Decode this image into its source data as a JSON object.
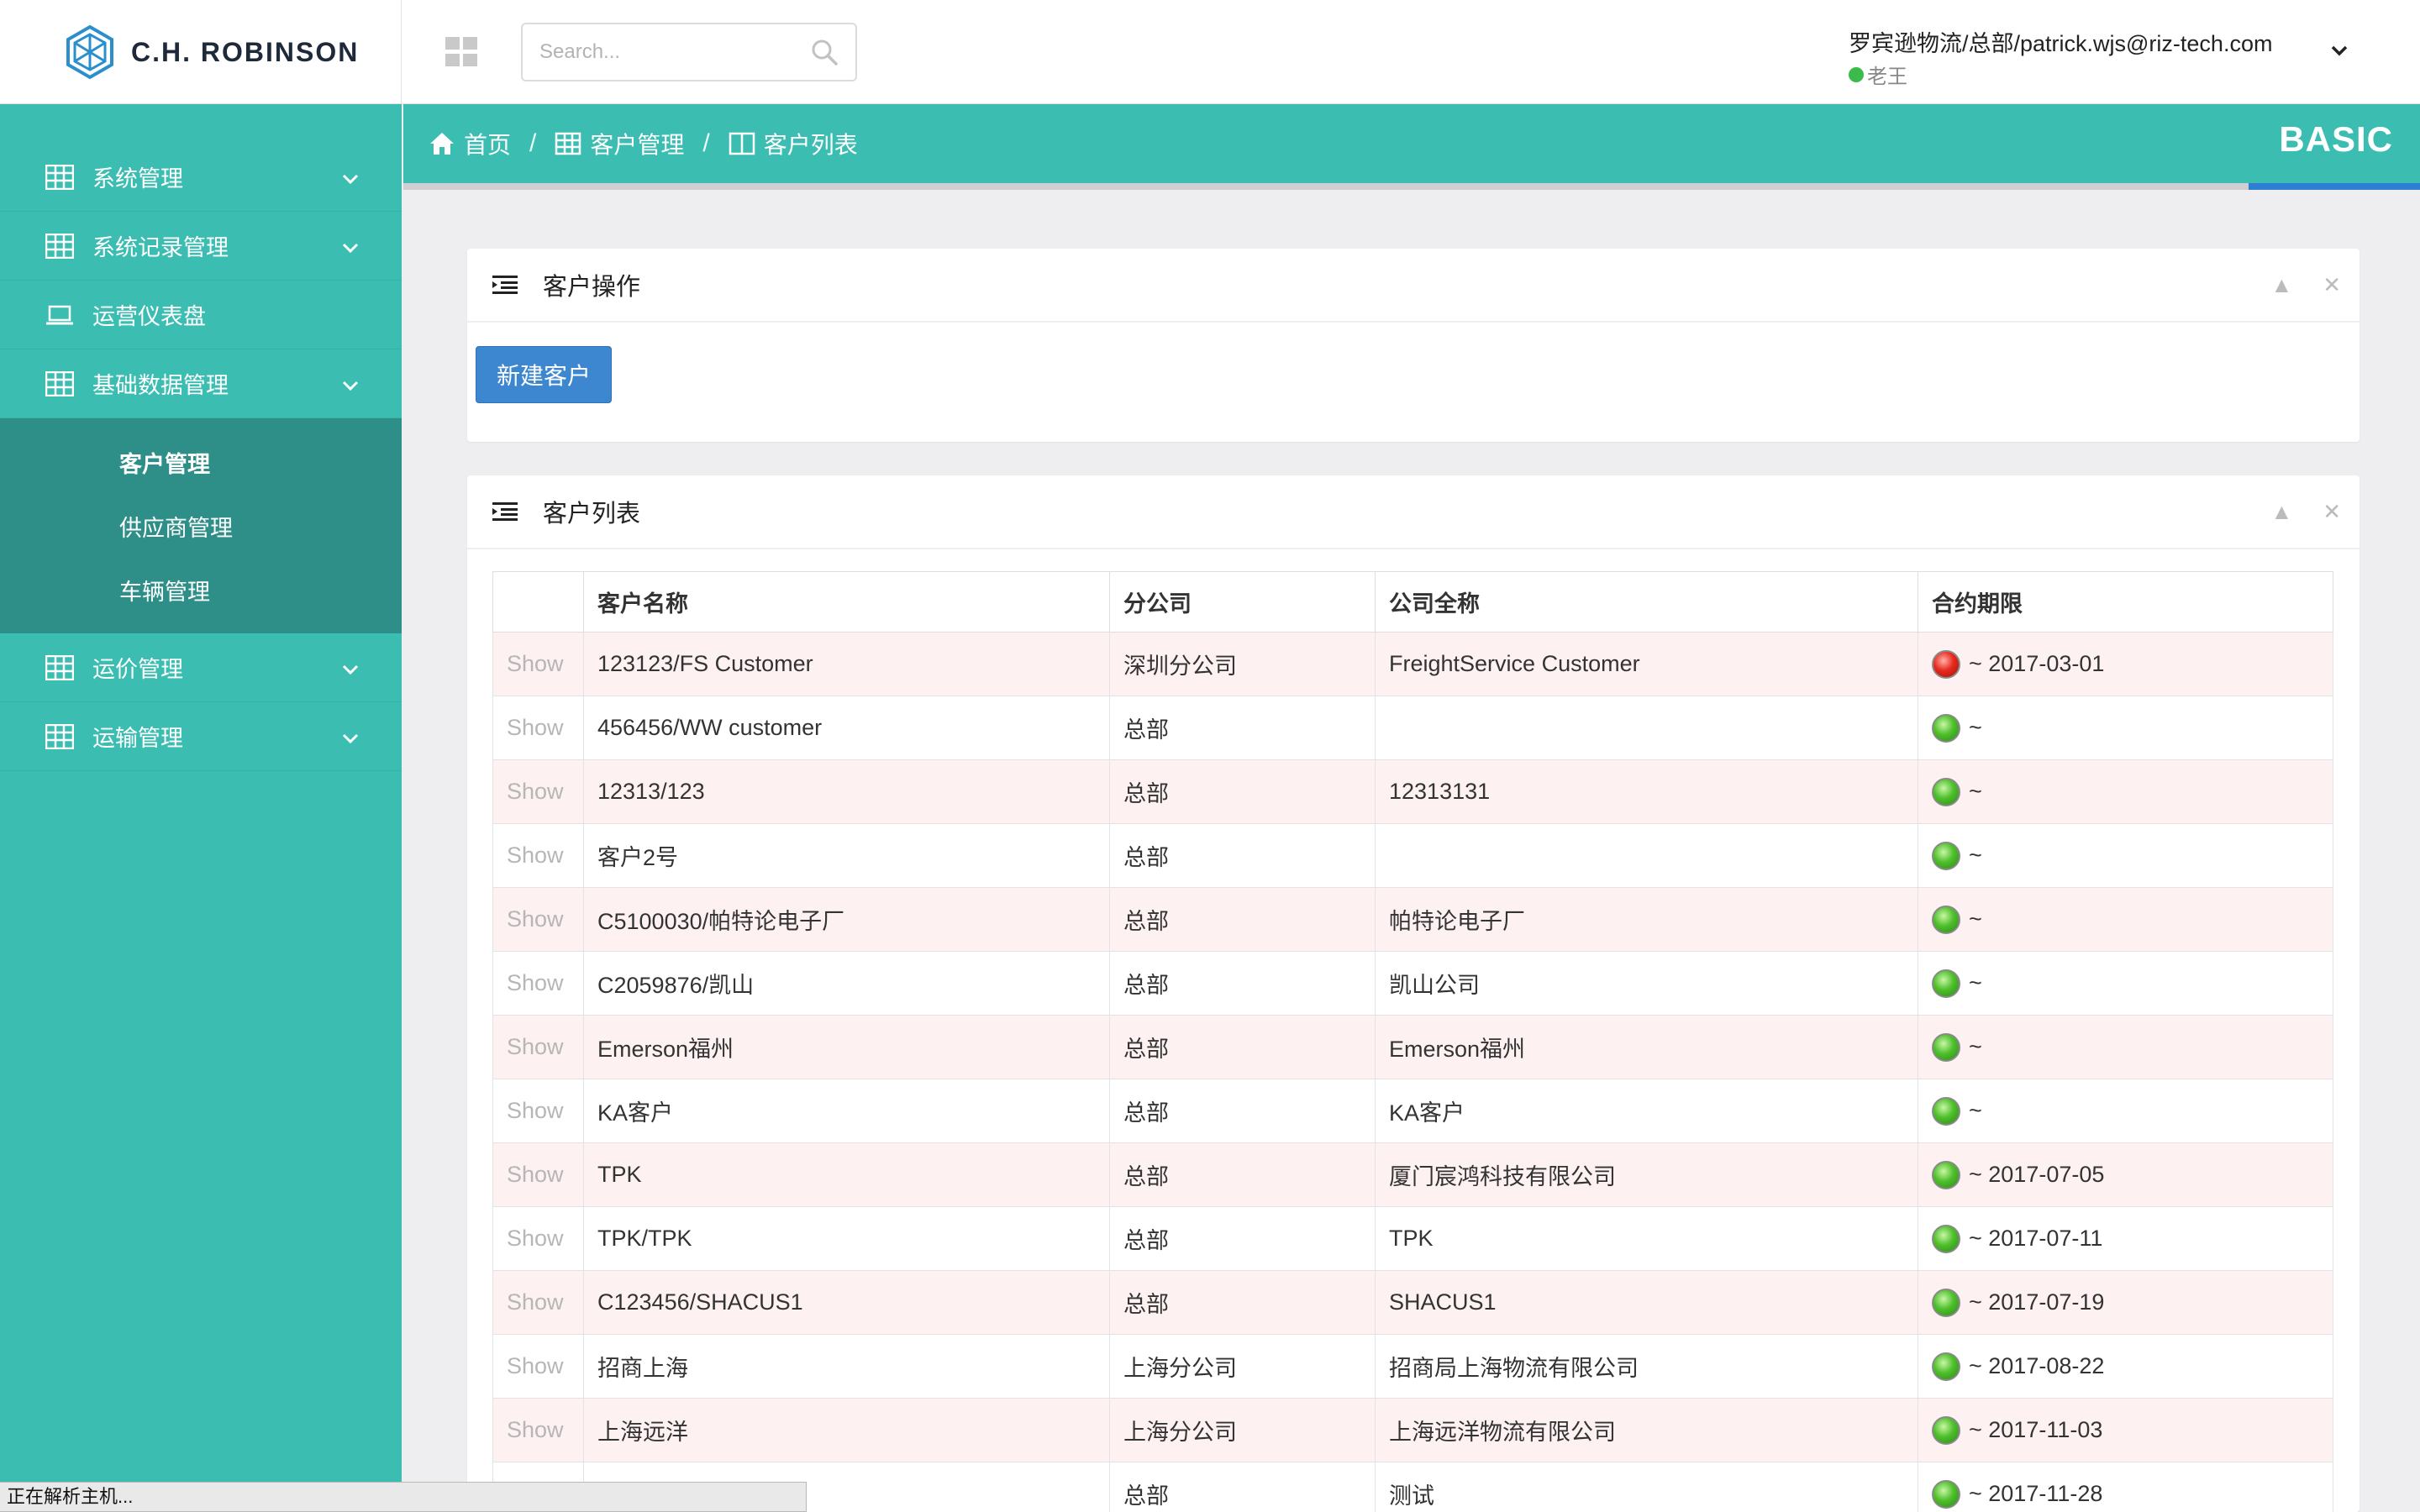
{
  "brand": {
    "name": "C.H. ROBINSON"
  },
  "search": {
    "placeholder": "Search..."
  },
  "user": {
    "name": "罗宾逊物流/总部/patrick.wjs@riz-tech.com",
    "status": "老王"
  },
  "sidebar": {
    "items": [
      {
        "label": "系统管理",
        "icon": "table-icon",
        "expandable": true
      },
      {
        "label": "系统记录管理",
        "icon": "table-icon",
        "expandable": true
      },
      {
        "label": "运营仪表盘",
        "icon": "laptop-icon",
        "expandable": false
      },
      {
        "label": "基础数据管理",
        "icon": "table-icon",
        "expandable": true
      },
      {
        "label": "运价管理",
        "icon": "table-icon",
        "expandable": true
      },
      {
        "label": "运输管理",
        "icon": "table-icon",
        "expandable": true
      }
    ],
    "submenu": [
      {
        "label": "客户管理",
        "active": true
      },
      {
        "label": "供应商管理",
        "active": false
      },
      {
        "label": "车辆管理",
        "active": false
      }
    ]
  },
  "breadcrumb": {
    "home": "首页",
    "section": "客户管理",
    "page": "客户列表",
    "tag": "BASIC"
  },
  "actions_panel": {
    "title": "客户操作",
    "new_button": "新建客户"
  },
  "list_panel": {
    "title": "客户列表",
    "columns": [
      "",
      "客户名称",
      "分公司",
      "公司全称",
      "合约期限"
    ],
    "rows": [
      {
        "action": "Show",
        "name": "123123/FS Customer",
        "branch": "深圳分公司",
        "full_name": "FreightService Customer",
        "status": "red",
        "term": "~ 2017-03-01"
      },
      {
        "action": "Show",
        "name": "456456/WW customer",
        "branch": "总部",
        "full_name": "",
        "status": "green",
        "term": "~"
      },
      {
        "action": "Show",
        "name": "12313/123",
        "branch": "总部",
        "full_name": "12313131",
        "status": "green",
        "term": "~"
      },
      {
        "action": "Show",
        "name": "客户2号",
        "branch": "总部",
        "full_name": "",
        "status": "green",
        "term": "~"
      },
      {
        "action": "Show",
        "name": "C5100030/帕特论电子厂",
        "branch": "总部",
        "full_name": "帕特论电子厂",
        "status": "green",
        "term": "~"
      },
      {
        "action": "Show",
        "name": "C2059876/凯山",
        "branch": "总部",
        "full_name": "凯山公司",
        "status": "green",
        "term": "~"
      },
      {
        "action": "Show",
        "name": "Emerson福州",
        "branch": "总部",
        "full_name": "Emerson福州",
        "status": "green",
        "term": "~"
      },
      {
        "action": "Show",
        "name": "KA客户",
        "branch": "总部",
        "full_name": "KA客户",
        "status": "green",
        "term": "~"
      },
      {
        "action": "Show",
        "name": "TPK",
        "branch": "总部",
        "full_name": "厦门宸鸿科技有限公司",
        "status": "green",
        "term": "~ 2017-07-05"
      },
      {
        "action": "Show",
        "name": "TPK/TPK",
        "branch": "总部",
        "full_name": "TPK",
        "status": "green",
        "term": "~ 2017-07-11"
      },
      {
        "action": "Show",
        "name": "C123456/SHACUS1",
        "branch": "总部",
        "full_name": "SHACUS1",
        "status": "green",
        "term": "~ 2017-07-19"
      },
      {
        "action": "Show",
        "name": "招商上海",
        "branch": "上海分公司",
        "full_name": "招商局上海物流有限公司",
        "status": "green",
        "term": "~ 2017-08-22"
      },
      {
        "action": "Show",
        "name": "上海远洋",
        "branch": "上海分公司",
        "full_name": "上海远洋物流有限公司",
        "status": "green",
        "term": "~ 2017-11-03"
      },
      {
        "action": "",
        "name": "",
        "branch": "总部",
        "full_name": "测试",
        "status": "green",
        "term": "~ 2017-11-28"
      }
    ]
  },
  "statusbar": {
    "text": "正在解析主机..."
  },
  "colors": {
    "teal": "#3bbdb2",
    "teal_dark": "#2d8f88",
    "primary": "#3d86d0",
    "accent_blue": "#2e7fd1"
  }
}
